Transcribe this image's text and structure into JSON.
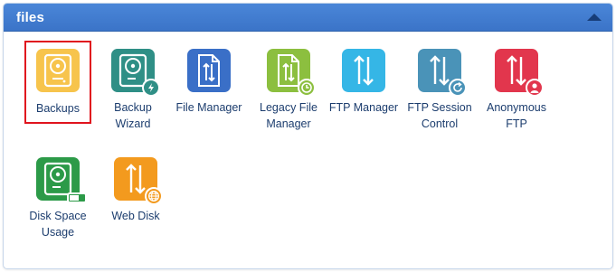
{
  "section": {
    "title": "files",
    "collapse_icon": "chevron-up-icon"
  },
  "items": [
    {
      "label": "Backups",
      "icon": "hard-drive-icon",
      "color": "#f7c44c",
      "selected": true
    },
    {
      "label": "Backup Wizard",
      "icon": "hard-drive-wizard-icon",
      "color": "#2f8f86"
    },
    {
      "label": "File Manager",
      "icon": "file-transfer-icon",
      "color": "#3a6fc7"
    },
    {
      "label": "Legacy File Manager",
      "icon": "file-transfer-clock-icon",
      "color": "#8cbf3f"
    },
    {
      "label": "FTP Manager",
      "icon": "up-down-arrows-icon",
      "color": "#35b6e6"
    },
    {
      "label": "FTP Session Control",
      "icon": "up-down-arrows-refresh-icon",
      "color": "#4a93b8"
    },
    {
      "label": "Anonymous FTP",
      "icon": "up-down-arrows-user-icon",
      "color": "#e2364d"
    },
    {
      "label": "Disk Space Usage",
      "icon": "hard-drive-usage-icon",
      "color": "#2c9a48"
    },
    {
      "label": "Web Disk",
      "icon": "up-down-arrows-globe-icon",
      "color": "#f39a1e"
    }
  ]
}
